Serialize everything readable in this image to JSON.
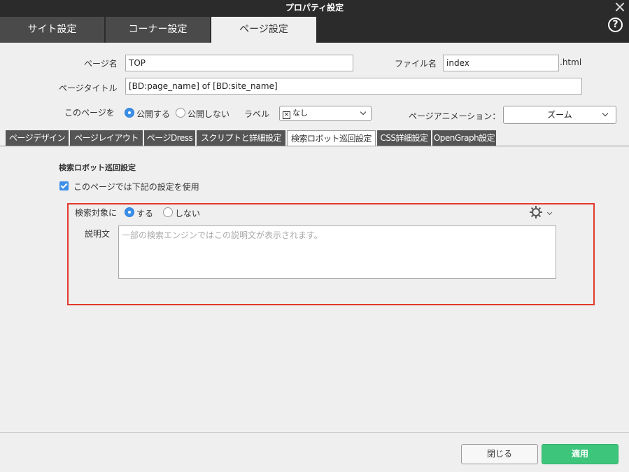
{
  "window": {
    "title": "プロパティ設定"
  },
  "top_tabs": [
    {
      "label": "サイト設定"
    },
    {
      "label": "コーナー設定"
    },
    {
      "label": "ページ設定"
    }
  ],
  "form": {
    "page_name_label": "ページ名",
    "page_name_value": "TOP",
    "file_name_label": "ファイル名",
    "file_name_value": "index",
    "file_ext": ".html",
    "page_title_label": "ページタイトル",
    "page_title_value": "[BD:page_name] of [BD:site_name]",
    "publish_label": "このページを",
    "publish_on": "公開する",
    "publish_off": "公開しない",
    "label_label": "ラベル",
    "label_value": "なし",
    "animation_label": "ページアニメーション：",
    "animation_value": "ズーム"
  },
  "sub_tabs": [
    {
      "label": "ページデザイン"
    },
    {
      "label": "ページレイアウト"
    },
    {
      "label": "ページDress"
    },
    {
      "label": "スクリプトと詳細設定"
    },
    {
      "label": "検索ロボット巡回設定"
    },
    {
      "label": "CSS詳細設定"
    },
    {
      "label": "OpenGraph設定"
    }
  ],
  "robot": {
    "section_title": "検索ロボット巡回設定",
    "use_settings_label": "このページでは下記の設定を使用",
    "target_label": "検索対象に",
    "target_yes": "する",
    "target_no": "しない",
    "description_label": "説明文",
    "description_placeholder": "一部の検索エンジンではこの説明文が表示されます。"
  },
  "footer": {
    "close_label": "閉じる",
    "apply_label": "適用"
  },
  "colors": {
    "accent": "#3b8fe8",
    "apply": "#3cc57b",
    "highlight": "#e23a2b"
  }
}
